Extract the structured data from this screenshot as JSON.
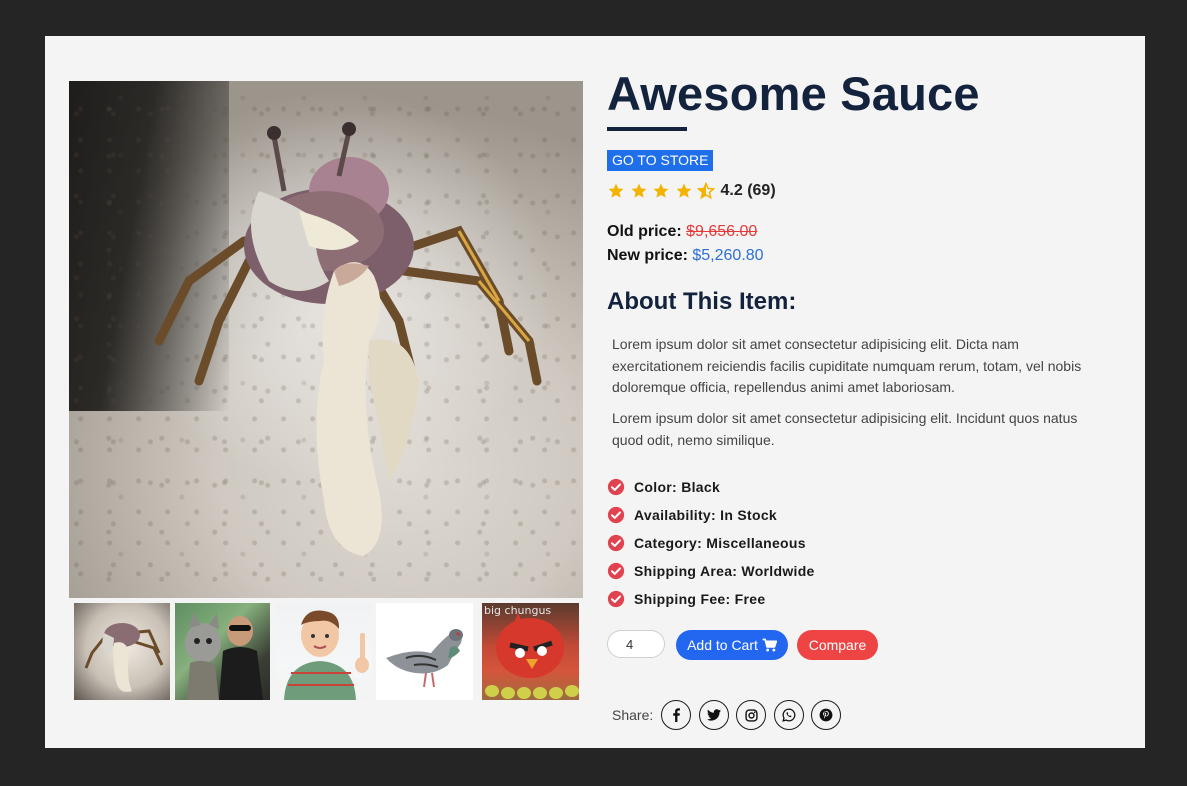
{
  "product": {
    "title": "Awesome Sauce",
    "store_button": "GO TO STORE",
    "rating": 4.2,
    "rating_text": "4.2 (69)",
    "old_price_label": "Old price:",
    "old_price": "$9,656.00",
    "new_price_label": "New price:",
    "new_price": "$5,260.80"
  },
  "about": {
    "heading": "About This Item:",
    "paragraphs": [
      "Lorem ipsum dolor sit amet consectetur adipisicing elit. Dicta nam exercitationem reiciendis facilis cupiditate numquam rerum, totam, vel nobis doloremque officia, repellendus animi amet laboriosam.",
      "Lorem ipsum dolor sit amet consectetur adipisicing elit. Incidunt quos natus quod odit, nemo similique."
    ]
  },
  "specs": [
    "Color: Black",
    "Availability: In Stock",
    "Category: Miscellaneous",
    "Shipping Area: Worldwide",
    "Shipping Fee: Free"
  ],
  "cart": {
    "quantity": "4",
    "add_to_cart": "Add to Cart",
    "compare": "Compare"
  },
  "share": {
    "label": "Share:",
    "icons": [
      "facebook-icon",
      "twitter-icon",
      "instagram-icon",
      "whatsapp-icon",
      "pinterest-icon"
    ]
  },
  "gallery": {
    "thumbnails": [
      "crab",
      "cat",
      "boy",
      "pigeon",
      "red-bird"
    ],
    "thumb5_caption": "big chungus"
  },
  "colors": {
    "title": "#13233d",
    "store_button": "#1f6feb",
    "star": "#f5b301",
    "old_price": "#e23b3b",
    "new_price": "#2b6fd6",
    "check": "#e0434f",
    "cart_button": "#2367f0",
    "compare_button": "#ef4444"
  }
}
